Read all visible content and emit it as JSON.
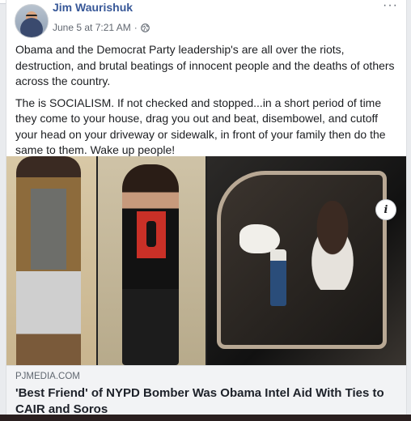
{
  "post": {
    "author": "Jim Waurishuk",
    "date": "June 5 at 7:21 AM",
    "separator": "·",
    "privacy_icon": "globe-icon",
    "more_icon": "more-options-icon",
    "more_glyph": "···",
    "paragraphs": [
      "Obama and the Democrat Party leadership's are all over the riots, destruction, and brutal beatings of innocent people and the deaths of others across the country.",
      "The is SOCIALISM. If not checked and stopped...in a short period of time they come to your house, drag you out and beat, disembowel, and cutoff your head on your driveway or sidewalk, in front of your family then do the same to them. Wake up people!"
    ]
  },
  "link": {
    "domain": "PJMEDIA.COM",
    "headline": "'Best Friend' of NYPD Bomber Was Obama Intel Aid With Ties to CAIR and Soros",
    "info_icon": "info-icon",
    "info_glyph": "i"
  },
  "colors": {
    "author": "#385898",
    "link_bg": "#f2f3f5",
    "page_bg": "#e9ebee"
  }
}
